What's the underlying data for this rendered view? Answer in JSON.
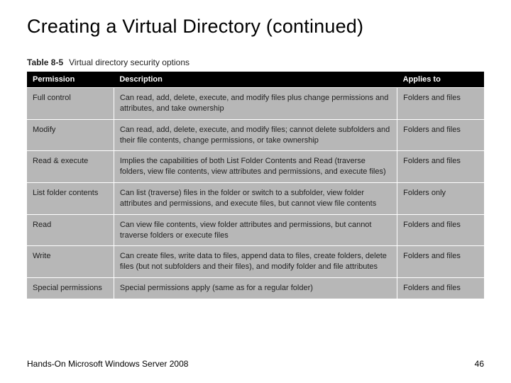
{
  "title": "Creating a Virtual Directory (continued)",
  "table": {
    "caption_number": "Table 8-5",
    "caption_text": "Virtual directory security options",
    "headers": {
      "permission": "Permission",
      "description": "Description",
      "applies": "Applies to"
    },
    "rows": [
      {
        "permission": "Full control",
        "description": "Can read, add, delete, execute, and modify files plus change permissions and attributes, and take ownership",
        "applies": "Folders and files"
      },
      {
        "permission": "Modify",
        "description": "Can read, add, delete, execute, and modify files; cannot delete subfolders and their file contents, change permissions, or take ownership",
        "applies": "Folders and files"
      },
      {
        "permission": "Read & execute",
        "description": "Implies the capabilities of both List Folder Contents and Read (traverse folders, view file contents, view attributes and permissions, and execute files)",
        "applies": "Folders and files"
      },
      {
        "permission": "List folder contents",
        "description": "Can list (traverse) files in the folder or switch to a subfolder, view folder attributes and permissions, and execute files, but cannot view file contents",
        "applies": "Folders only"
      },
      {
        "permission": "Read",
        "description": "Can view file contents, view folder attributes and permissions, but cannot traverse folders or execute files",
        "applies": "Folders and files"
      },
      {
        "permission": "Write",
        "description": "Can create files, write data to files, append data to files, create folders, delete files (but not subfolders and their files), and modify folder and file attributes",
        "applies": "Folders and files"
      },
      {
        "permission": "Special permissions",
        "description": "Special permissions apply (same as for a regular folder)",
        "applies": "Folders and files"
      }
    ]
  },
  "footer": {
    "book": "Hands-On Microsoft Windows Server 2008",
    "page": "46"
  },
  "chart_data": {
    "type": "table",
    "title": "Table 8-5 Virtual directory security options",
    "columns": [
      "Permission",
      "Description",
      "Applies to"
    ],
    "rows": [
      [
        "Full control",
        "Can read, add, delete, execute, and modify files plus change permissions and attributes, and take ownership",
        "Folders and files"
      ],
      [
        "Modify",
        "Can read, add, delete, execute, and modify files; cannot delete subfolders and their file contents, change permissions, or take ownership",
        "Folders and files"
      ],
      [
        "Read & execute",
        "Implies the capabilities of both List Folder Contents and Read (traverse folders, view file contents, view attributes and permissions, and execute files)",
        "Folders and files"
      ],
      [
        "List folder contents",
        "Can list (traverse) files in the folder or switch to a subfolder, view folder attributes and permissions, and execute files, but cannot view file contents",
        "Folders only"
      ],
      [
        "Read",
        "Can view file contents, view folder attributes and permissions, but cannot traverse folders or execute files",
        "Folders and files"
      ],
      [
        "Write",
        "Can create files, write data to files, append data to files, create folders, delete files (but not subfolders and their files), and modify folder and file attributes",
        "Folders and files"
      ],
      [
        "Special permissions",
        "Special permissions apply (same as for a regular folder)",
        "Folders and files"
      ]
    ]
  }
}
